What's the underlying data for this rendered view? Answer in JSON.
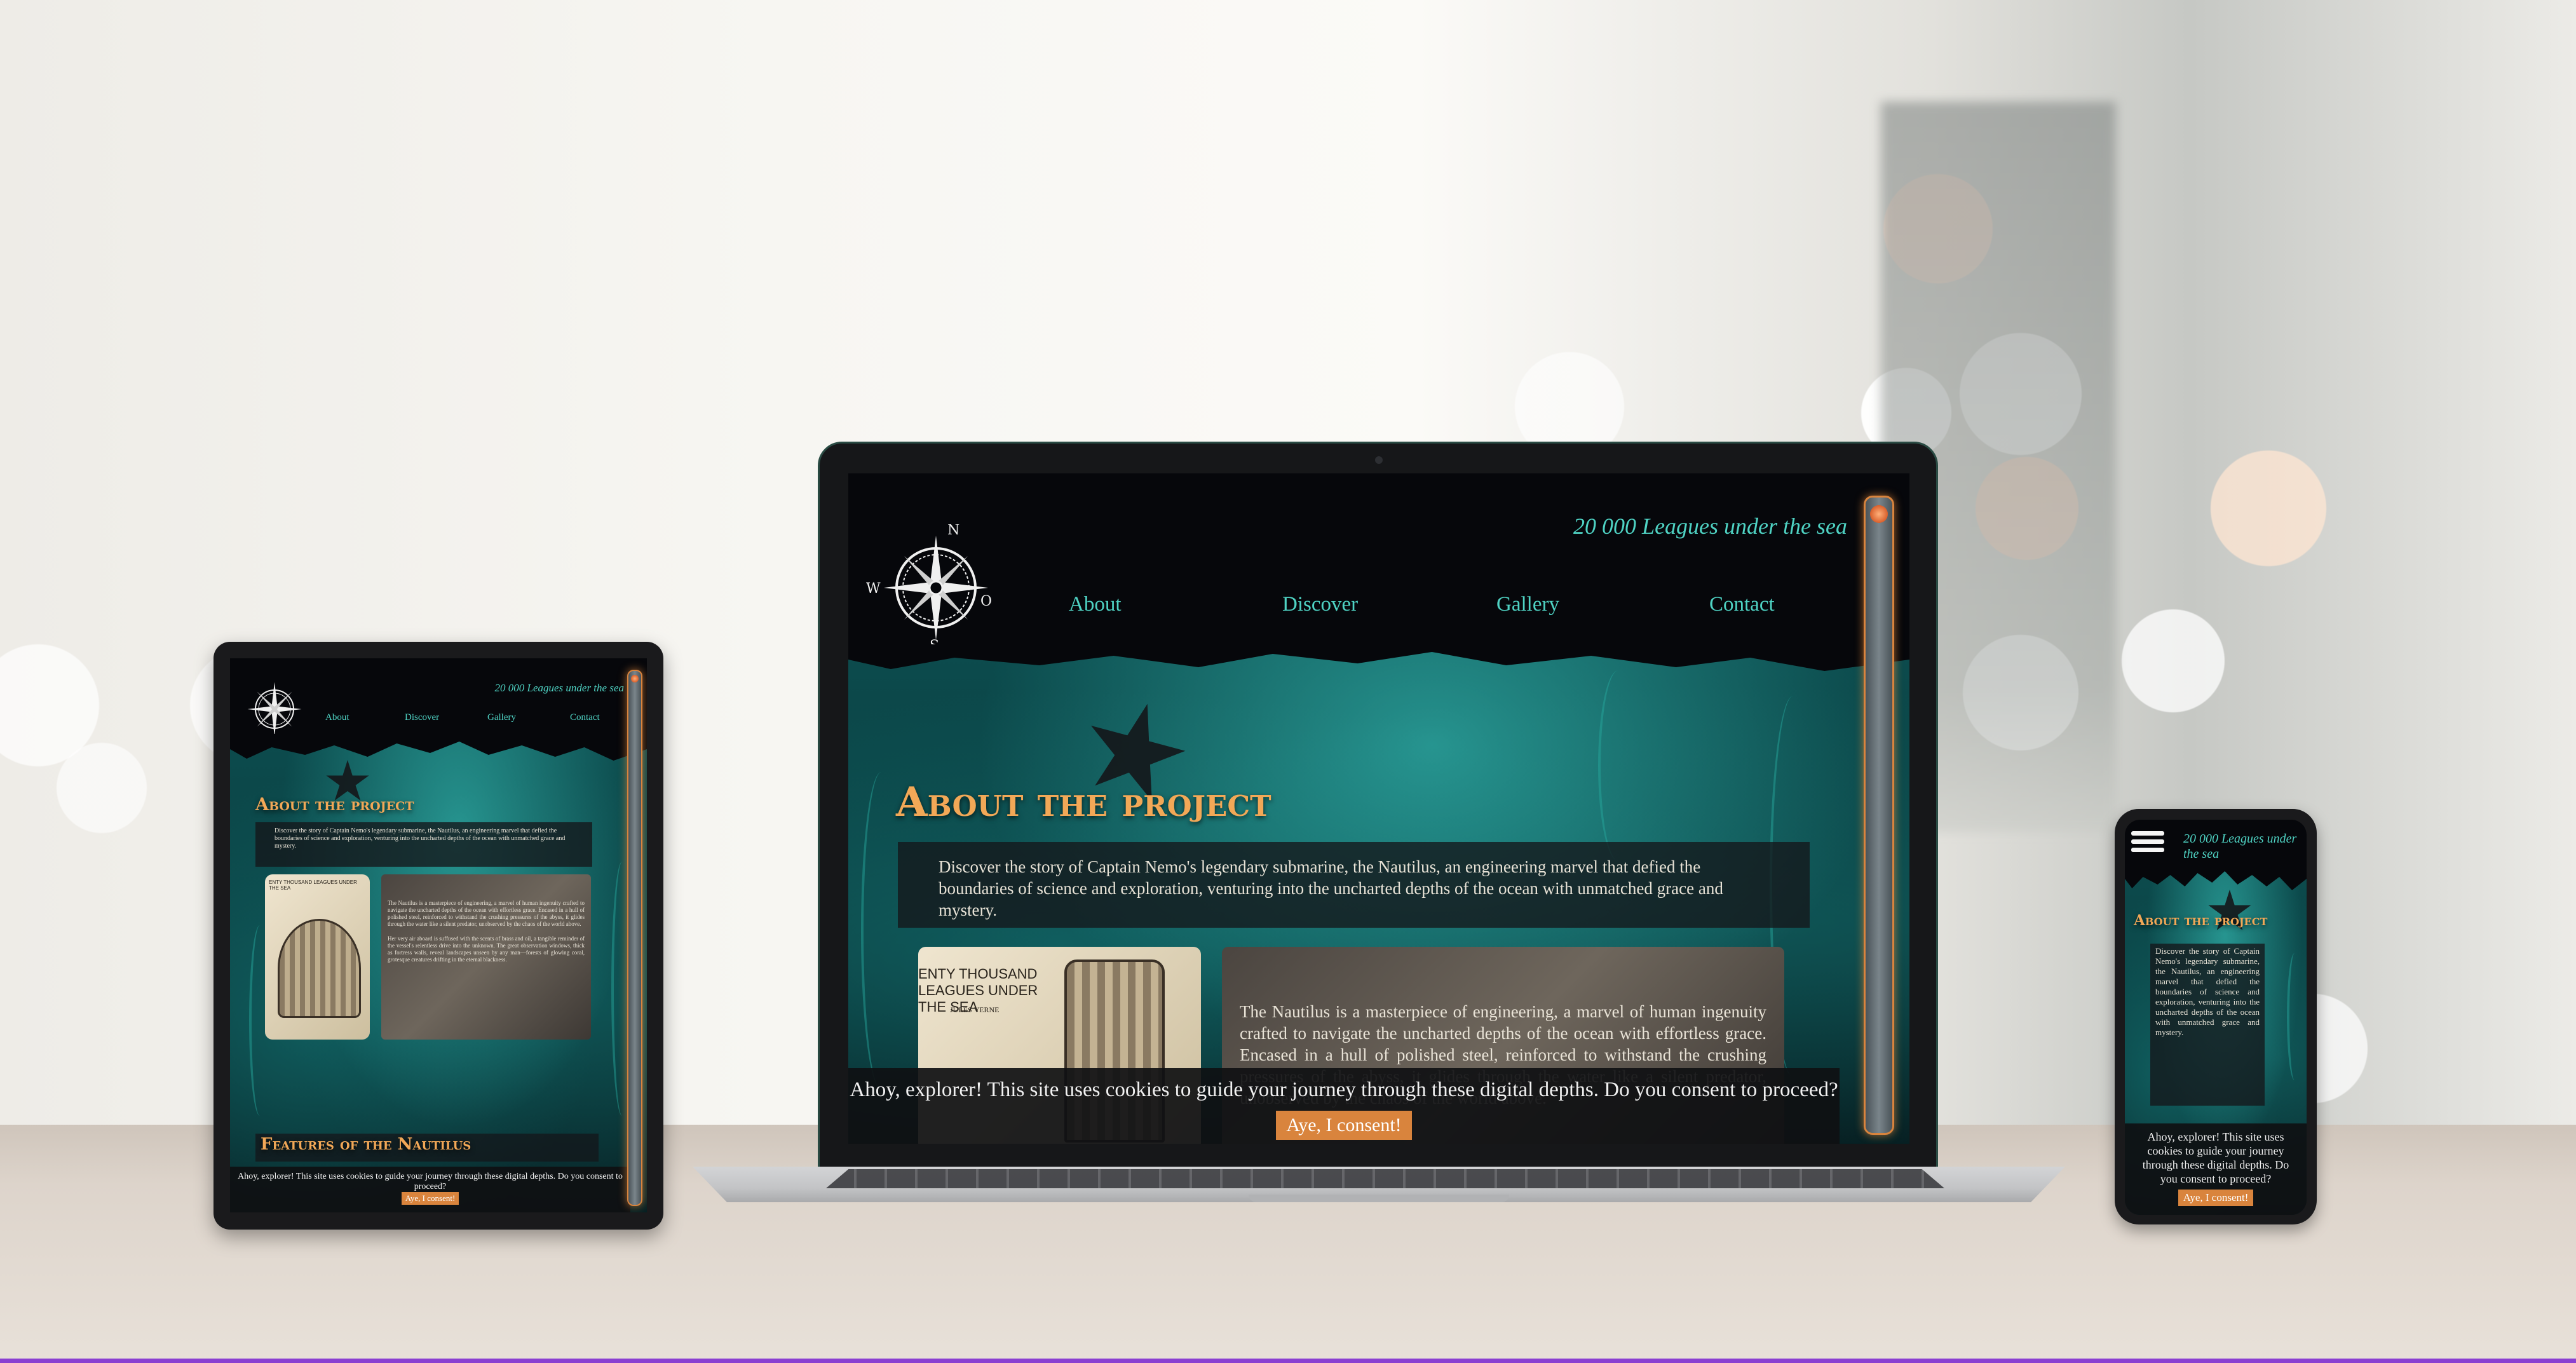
{
  "site": {
    "brand": "20 000 Leagues under the sea",
    "nav": [
      "About",
      "Discover",
      "Gallery",
      "Contact"
    ],
    "compass": {
      "n": "N",
      "s": "S",
      "w": "W",
      "o": "O"
    },
    "section_title": "About the project",
    "intro": "Discover the story of Captain Nemo's legendary submarine, the Nautilus, an engineering marvel that defied the boundaries of science and exploration, venturing into the uncharted depths of the ocean with unmatched grace and mystery.",
    "card_text_1": "The Nautilus is a masterpiece of engineering, a marvel of human ingenuity crafted to navigate the uncharted depths of the ocean with effortless grace. Encased in a hull of polished steel, reinforced to withstand the crushing pressures of the abyss, it glides through the water like a silent predator, unobserved by the chaos of the world above.",
    "card_text_2": "Her very air aboard is suffused with the scents of brass and oil, a tangible reminder of the vessel's relentless drive into the unknown. The great observation windows, thick as fortress walls, reveal landscapes unseen by any man—forests of glowing coral, grotesque creatures drifting in the eternal blackness.",
    "card_image_caption": "ENTY THOUSAND LEAGUES UNDER THE SEA",
    "card_image_author": "JULES VERNE",
    "second_section_title": "Features of the Nautilus",
    "cookie_text": "Ahoy, explorer! This site uses cookies to guide your journey through these digital depths. Do you consent to proceed?",
    "cookie_button": "Aye, I consent!"
  },
  "colors": {
    "accent": "#d9843d",
    "title": "#f2a857",
    "link": "#4fd3c4",
    "background": "#06070b"
  },
  "icons": [
    "compass-rose-icon",
    "hamburger-menu-icon",
    "starfish-silhouette"
  ]
}
